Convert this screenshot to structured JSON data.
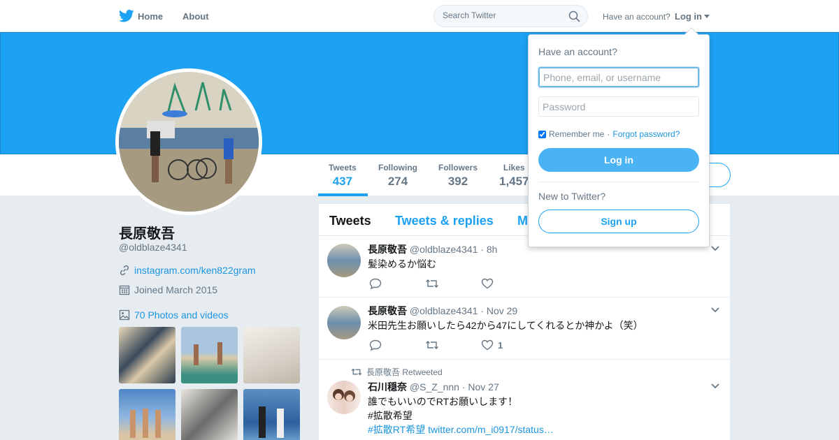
{
  "nav": {
    "home_label": "Home",
    "about_label": "About",
    "search_placeholder": "Search Twitter",
    "have_account": "Have an account?",
    "login_label": "Log in"
  },
  "colors": {
    "accent": "#1da1f2",
    "banner": "#1da1f2",
    "link": "#1b95e0",
    "muted": "#657786"
  },
  "profile": {
    "name": "長原敬吾",
    "handle": "@oldblaze4341",
    "website": "instagram.com/ken822gram",
    "joined": "Joined March 2015",
    "photos_label": "70 Photos and videos"
  },
  "stats": [
    {
      "label": "Tweets",
      "value": "437"
    },
    {
      "label": "Following",
      "value": "274"
    },
    {
      "label": "Followers",
      "value": "392"
    },
    {
      "label": "Likes",
      "value": "1,457"
    }
  ],
  "timeline_tabs": [
    {
      "label": "Tweets"
    },
    {
      "label": "Tweets & replies"
    },
    {
      "label": "M"
    }
  ],
  "tweets": [
    {
      "name": "長原敬吾",
      "handle": "@oldblaze4341",
      "time": "· 8h",
      "text": "髪染めるか悩む",
      "likes": ""
    },
    {
      "name": "長原敬吾",
      "handle": "@oldblaze4341",
      "time": "· Nov 29",
      "text": "米田先生お願いしたら42から47にしてくれるとか神かよ（笑）",
      "likes": "1"
    },
    {
      "retweet_context": "長原敬吾 Retweeted",
      "name": "石川穏奈",
      "handle": "@S_Z_nnn",
      "time": "· Nov 27",
      "text": "誰でもいいのでRTお願いします！",
      "hashtag1": "#拡散希望",
      "hashtag2": "#拡散RT希望",
      "link": "twitter.com/m_i0917/status…"
    }
  ],
  "login_dropdown": {
    "title": "Have an account?",
    "username_placeholder": "Phone, email, or username",
    "password_placeholder": "Password",
    "remember": "Remember me",
    "separator": "·",
    "forgot": "Forgot password?",
    "login_button": "Log in",
    "new_label": "New to Twitter?",
    "signup_button": "Sign up"
  }
}
